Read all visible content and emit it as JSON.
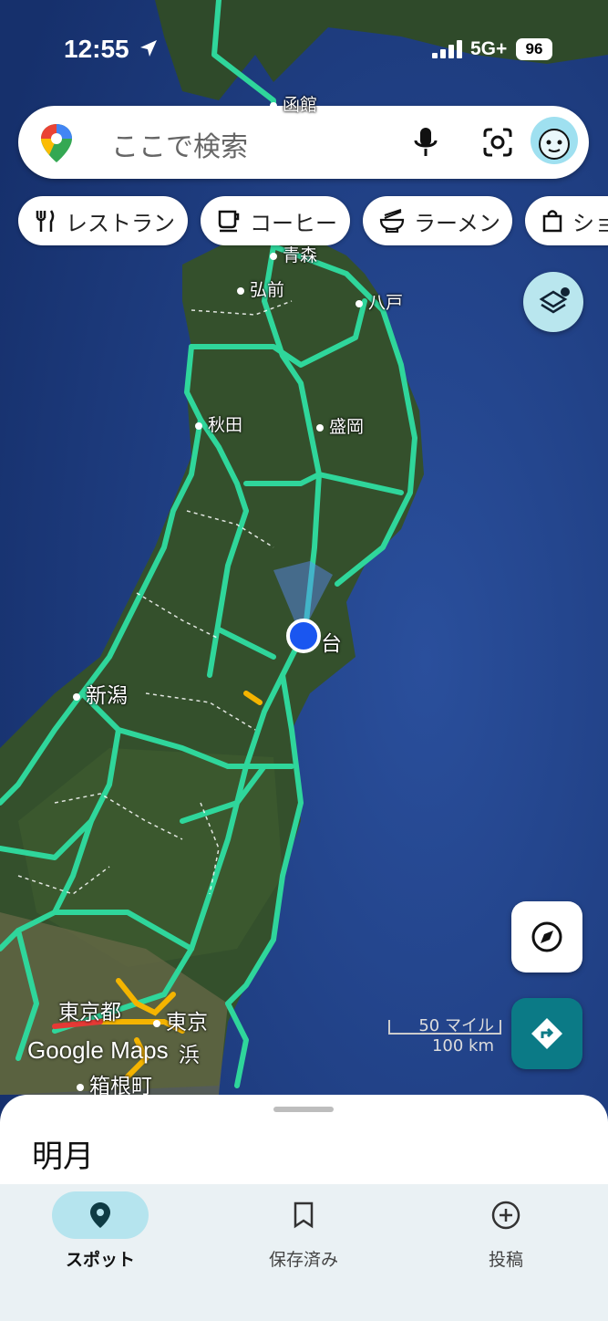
{
  "status_bar": {
    "time": "12:55",
    "network": "5G+",
    "battery": "96"
  },
  "search": {
    "placeholder": "ここで検索"
  },
  "chips": [
    {
      "label": "レストラン",
      "icon": "restaurant-icon"
    },
    {
      "label": "コーヒー",
      "icon": "coffee-icon"
    },
    {
      "label": "ラーメン",
      "icon": "ramen-icon"
    },
    {
      "label": "ショ",
      "icon": "shopping-bag-icon"
    }
  ],
  "map": {
    "labels": {
      "hakodate": "函館",
      "aomori": "青森",
      "hirosaki": "弘前",
      "hachinohe": "八戸",
      "akita": "秋田",
      "morioka": "盛岡",
      "sendai": "台",
      "niigata": "新潟",
      "tokyo_to": "東京都",
      "tokyo": "東京",
      "yokohama": "浜",
      "hakone": "箱根町"
    },
    "logo": "Google Maps",
    "scale": {
      "miles": "50 マイル",
      "km": "100 km"
    },
    "colors": {
      "road": "#2fd69b",
      "congestion": "#f4b400",
      "heavy": "#e53935",
      "location": "#1a56f0"
    }
  },
  "sheet": {
    "title": "明月"
  },
  "nav": {
    "spot": "スポット",
    "saved": "保存済み",
    "post": "投稿"
  }
}
